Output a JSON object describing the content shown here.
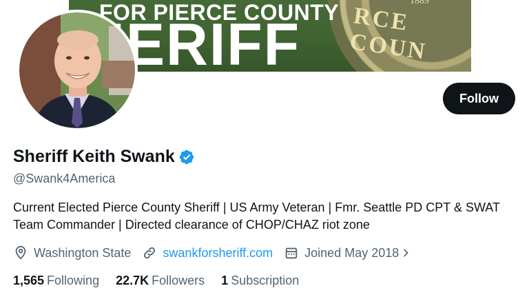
{
  "banner": {
    "line1": "FOR PIERCE COUNTY",
    "line2": "HERIFF",
    "badge_text": "RCE COUN",
    "badge_year": "1889",
    "bg_color": "#466a37"
  },
  "profile": {
    "display_name": "Sheriff Keith Swank",
    "handle": "@Swank4America",
    "verified": true,
    "verified_icon": "verified-badge-icon",
    "bio": "Current Elected Pierce County Sheriff | US Army Veteran | Fmr. Seattle PD CPT & SWAT Team Commander | Directed clearance of CHOP/CHAZ riot zone"
  },
  "actions": {
    "follow_label": "Follow"
  },
  "meta": {
    "location": "Washington State",
    "location_icon": "location-pin-icon",
    "website": "swankforsheriff.com",
    "website_icon": "link-icon",
    "joined": "Joined May 2018",
    "joined_icon": "calendar-icon"
  },
  "stats": {
    "following_count": "1,565",
    "following_label": "Following",
    "followers_count": "22.7K",
    "followers_label": "Followers",
    "subscription_count": "1",
    "subscription_label": "Subscription"
  },
  "colors": {
    "text_primary": "#0f1419",
    "text_secondary": "#536471",
    "link": "#1d9bf0",
    "button_bg": "#0f1419"
  }
}
